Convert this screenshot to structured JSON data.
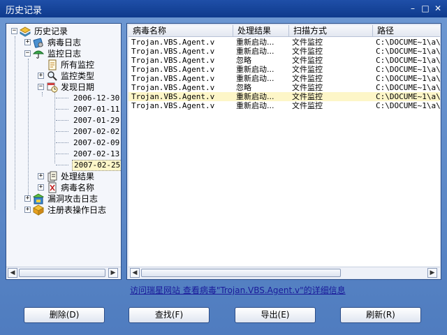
{
  "window": {
    "title": "历史记录",
    "minimize": "–",
    "maximize": "□",
    "close": "✕"
  },
  "tree": {
    "root": "历史记录",
    "virus_log": "病毒日志",
    "monitor_log": "监控日志",
    "all_monitor": "所有监控",
    "monitor_type": "监控类型",
    "found_date": "发现日期",
    "dates": [
      "2006-12-30",
      "2007-01-11",
      "2007-01-29",
      "2007-02-02",
      "2007-02-09",
      "2007-02-13",
      "2007-02-25"
    ],
    "process_result": "处理结果",
    "virus_name": "病毒名称",
    "vuln_log": "漏洞攻击日志",
    "registry_log": "注册表操作日志"
  },
  "list": {
    "columns": [
      "病毒名称",
      "处理结果",
      "扫描方式",
      "路径"
    ],
    "rows": [
      [
        "Trojan.VBS.Agent.v",
        "重新启动...",
        "文件监控",
        "C:\\DOCUME~1\\a\\L"
      ],
      [
        "Trojan.VBS.Agent.v",
        "重新启动...",
        "文件监控",
        "C:\\DOCUME~1\\a\\L"
      ],
      [
        "Trojan.VBS.Agent.v",
        "忽略",
        "文件监控",
        "C:\\DOCUME~1\\a\\L"
      ],
      [
        "Trojan.VBS.Agent.v",
        "重新启动...",
        "文件监控",
        "C:\\DOCUME~1\\a\\L"
      ],
      [
        "Trojan.VBS.Agent.v",
        "重新启动...",
        "文件监控",
        "C:\\DOCUME~1\\a\\L"
      ],
      [
        "Trojan.VBS.Agent.v",
        "忽略",
        "文件监控",
        "C:\\DOCUME~1\\a\\L"
      ],
      [
        "Trojan.VBS.Agent.v",
        "重新启动...",
        "文件监控",
        "C:\\DOCUME~1\\a\\L"
      ],
      [
        "Trojan.VBS.Agent.v",
        "重新启动...",
        "文件监控",
        "C:\\DOCUME~1\\a\\L"
      ]
    ],
    "selected_row": 6
  },
  "link_text": "访问瑞星网站 查看病毒\"Trojan.VBS.Agent.v\"的详细信息",
  "buttons": {
    "delete": "删除(D)",
    "find": "查找(F)",
    "export": "导出(E)",
    "refresh": "刷新(R)"
  },
  "scroll": {
    "left": "◀",
    "right": "▶"
  },
  "colors": {
    "title_bar": "#1f4fa8",
    "window_bg": "#5a86c4",
    "selection": "#fdf6c8"
  }
}
